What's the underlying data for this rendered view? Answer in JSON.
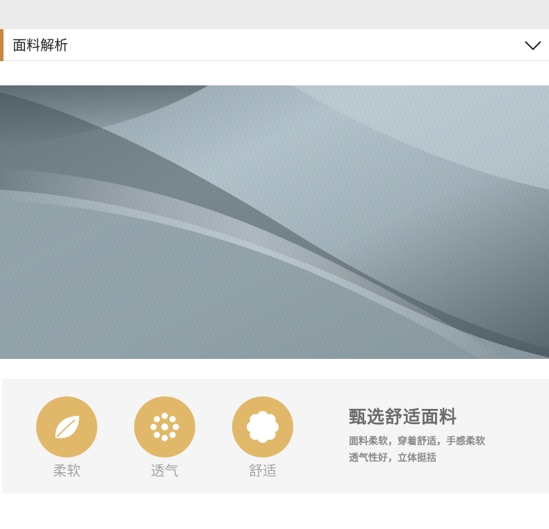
{
  "header": {
    "title": "面料解析",
    "toggle_icon": "chevron-down-icon",
    "accent_color": "#c8873a"
  },
  "fabric_image": {
    "subject": "blue-grey twill fabric close-up",
    "color": "#a9bac3"
  },
  "features": [
    {
      "label": "柔软",
      "icon": "leaf-icon"
    },
    {
      "label": "透气",
      "icon": "flower-icon"
    },
    {
      "label": "舒适",
      "icon": "cloud-icon"
    }
  ],
  "feature_circle_color": "#e1b86a",
  "promo": {
    "heading": "甄选舒适面料",
    "line1": "面料柔软，穿着舒适，手感柔软",
    "line2": "透气性好，立体挺括"
  }
}
